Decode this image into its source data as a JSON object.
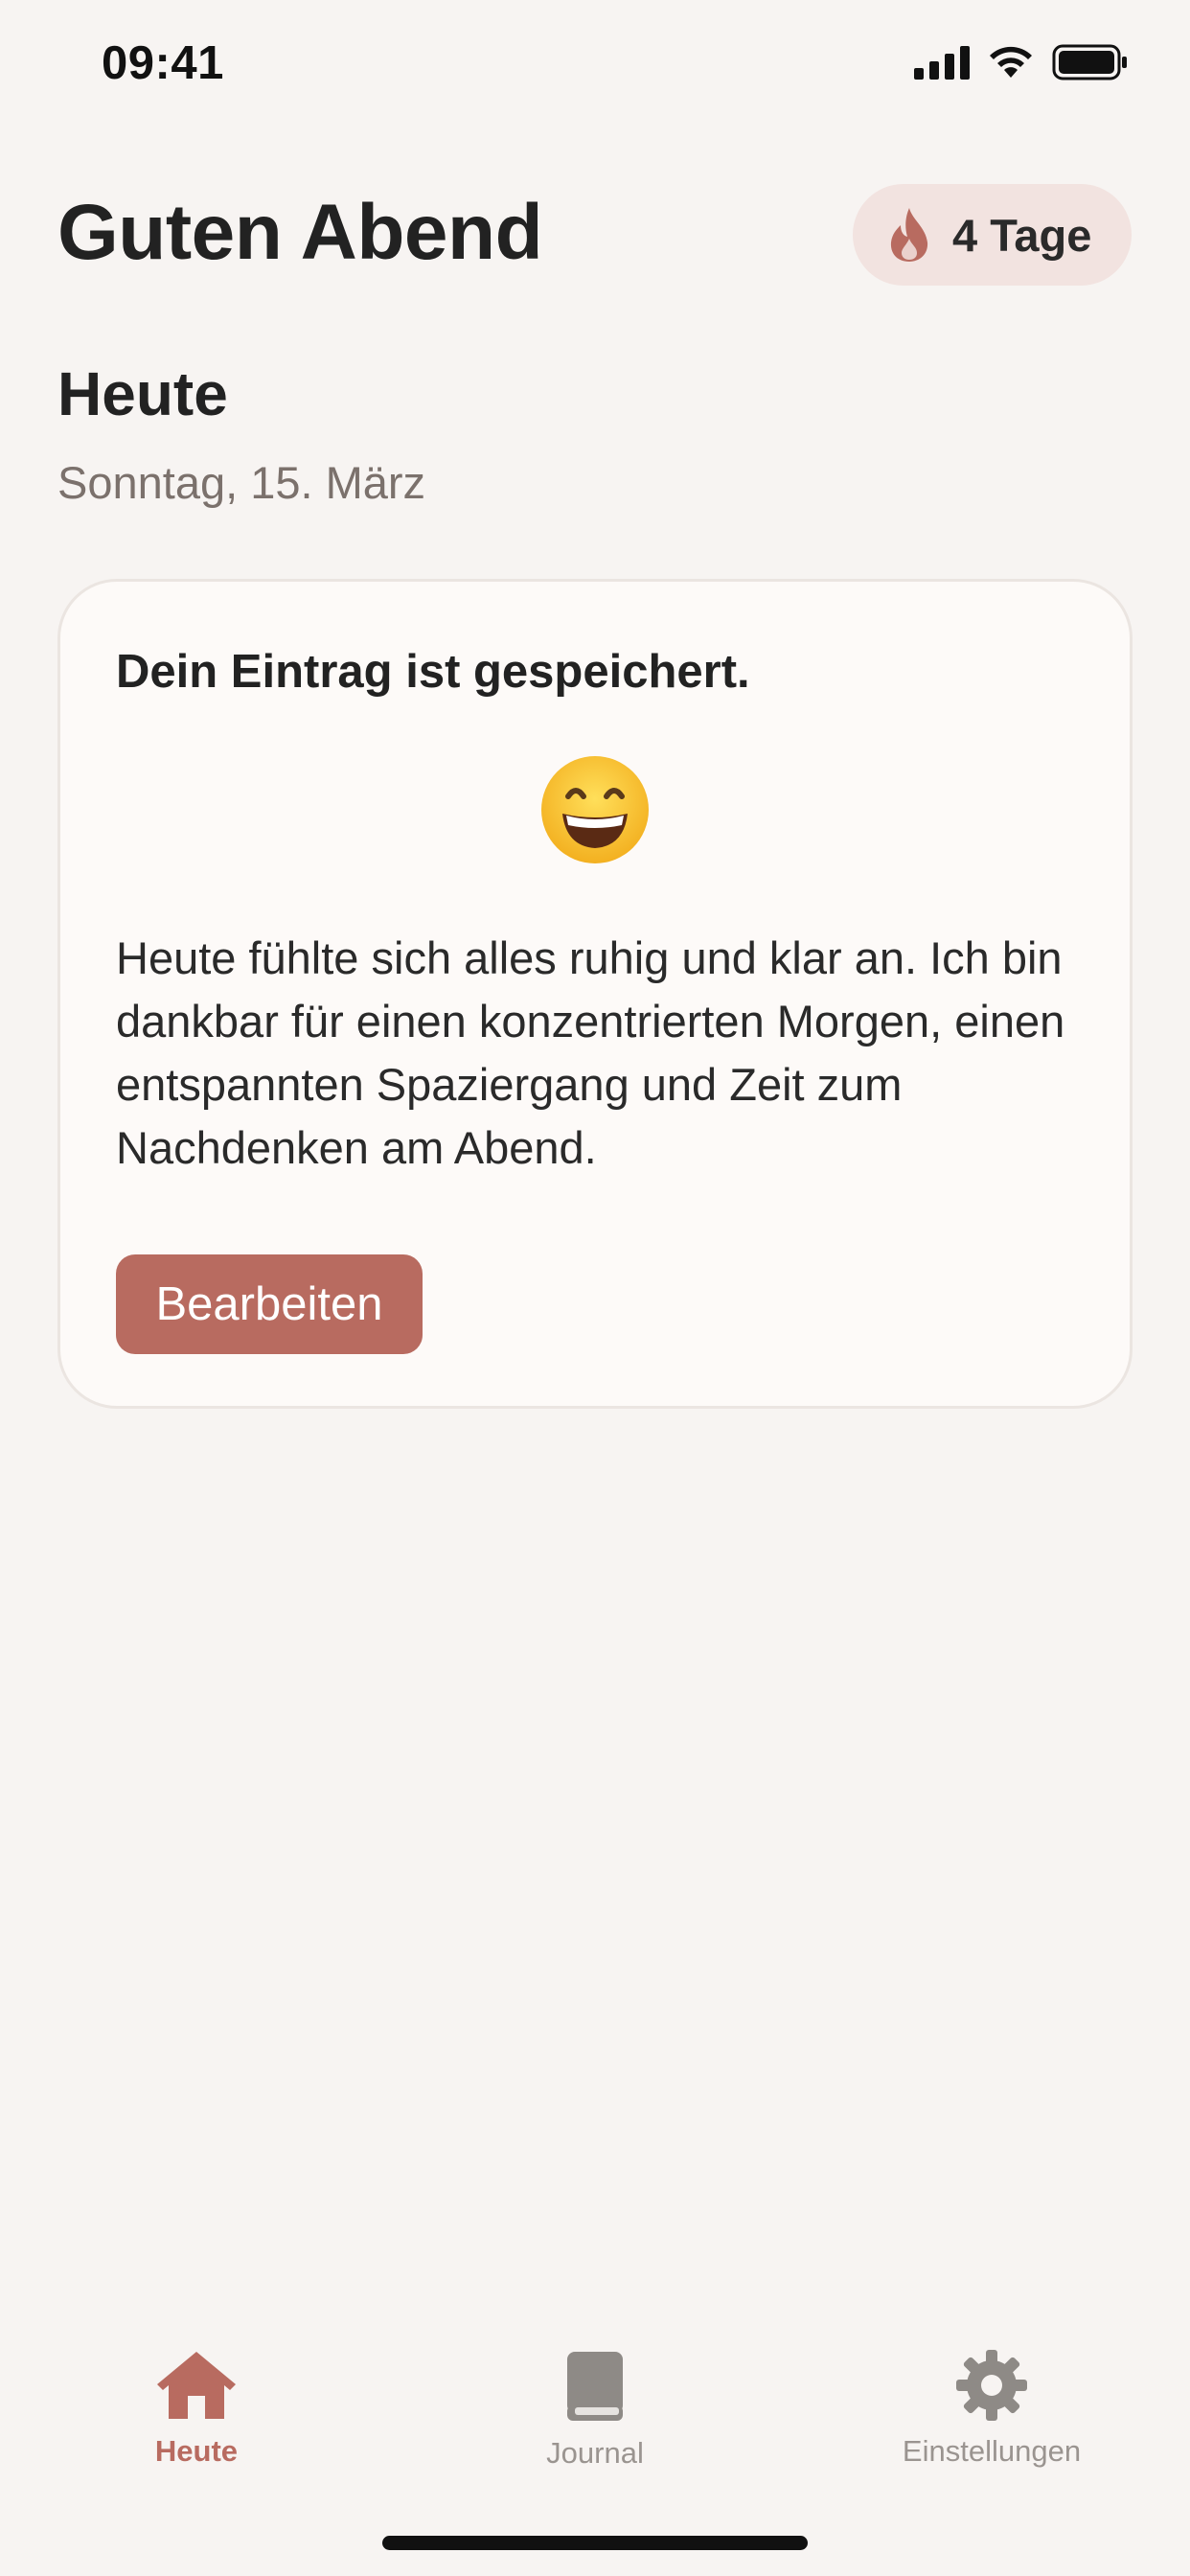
{
  "status_bar": {
    "time": "09:41"
  },
  "header": {
    "greeting": "Guten Abend",
    "streak_label": "4 Tage",
    "streak_icon": "flame-icon"
  },
  "section": {
    "title": "Heute",
    "date": "Sonntag, 15. März"
  },
  "entry": {
    "saved_message": "Dein Eintrag ist gespeichert.",
    "mood_emoji": "grinning-face-icon",
    "text": "Heute fühlte sich alles ruhig und klar an. Ich bin dankbar für einen konzentrierten Morgen, einen entspannten Spaziergang und Zeit zum Nachdenken am Abend.",
    "edit_label": "Bearbeiten"
  },
  "tabs": [
    {
      "label": "Heute",
      "icon": "house-icon",
      "active": true
    },
    {
      "label": "Journal",
      "icon": "book-icon",
      "active": false
    },
    {
      "label": "Einstellungen",
      "icon": "gear-icon",
      "active": false
    }
  ],
  "colors": {
    "accent": "#b86b60",
    "background": "#f7f4f2",
    "card": "#fdfaf8",
    "pill": "#f2e3e0"
  }
}
